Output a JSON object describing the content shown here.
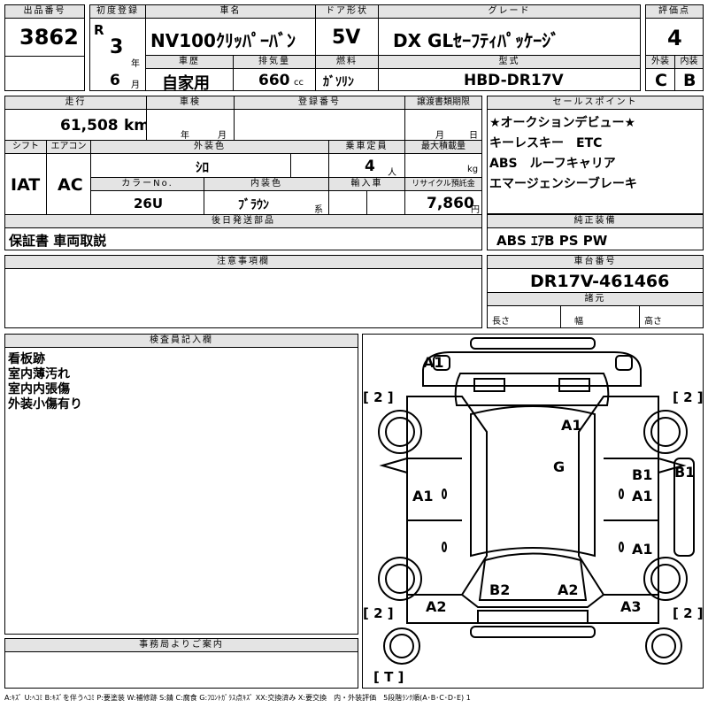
{
  "header": {
    "lot_no_label": "出品番号",
    "lot_no": "3862",
    "first_reg_label": "初度登録",
    "era": "R",
    "reg_year": "3",
    "year_unit": "年",
    "reg_month": "6",
    "month_unit": "月",
    "car_name_label": "車名",
    "car_name": "NV100ｸﾘｯﾊﾟｰﾊﾞﾝ",
    "door_label": "ドア形状",
    "door": "5V",
    "grade_label": "グレード",
    "grade": "DX GLｾｰﾌﾃｨﾊﾟｯｹｰｼﾞ",
    "score_label": "評価点",
    "score": "4",
    "history_label": "車歴",
    "history": "自家用",
    "displacement_label": "排気量",
    "displacement": "660",
    "displacement_unit": "cc",
    "fuel_label": "燃料",
    "fuel": "ｶﾞｿﾘﾝ",
    "model_label": "型式",
    "model": "HBD-DR17V",
    "exterior_label": "外装",
    "exterior": "C",
    "interior_label": "内装",
    "interior": "B"
  },
  "details": {
    "mileage_label": "走行",
    "mileage": "61,508",
    "mileage_unit": "km",
    "inspection_label": "車検",
    "insp_year_unit": "年",
    "insp_month_unit": "月",
    "plate_label": "登録番号",
    "transfer_label": "譲渡書類期限",
    "transfer_month_unit": "月",
    "transfer_day_unit": "日",
    "shift_label": "シフト",
    "shift": "IAT",
    "ac_label": "エアコン",
    "ac": "AC",
    "ext_color_label": "外装色",
    "ext_color": "ｼﾛ",
    "seats_label": "乗車定員",
    "seats": "4",
    "seats_unit": "人",
    "max_load_label": "最大積載量",
    "max_load_unit": "kg",
    "color_no_label": "カラーNo.",
    "color_no": "26U",
    "int_color_label": "内装色",
    "int_color": "ﾌﾞﾗｳﾝ",
    "int_color_unit": "系",
    "import_label": "輸入車",
    "recycle_label": "リサイクル預託金",
    "recycle": "7,860",
    "recycle_unit": "円",
    "later_items_label": "後日発送部品",
    "later_items": "保証書 車両取説",
    "notes_label": "注意事項欄"
  },
  "selling_points": {
    "label": "セールスポイント",
    "lines": [
      "★オークションデビュー★",
      "キーレスキー　ETC",
      "ABS　ルーフキャリア",
      "エマージェンシーブレーキ"
    ]
  },
  "equipment": {
    "label": "純正装備",
    "value": "ABS ｴｱB PS PW"
  },
  "chassis": {
    "label": "車台番号",
    "value": "DR17V-461466",
    "spec_label": "諸元",
    "length_label": "長さ",
    "width_label": "幅",
    "height_label": "高さ"
  },
  "inspector": {
    "label": "検査員記入欄",
    "lines": [
      "看板跡",
      "室内薄汚れ",
      "室内内張傷",
      "外装小傷有り"
    ]
  },
  "diagram": {
    "marks": {
      "m_a1_top": "A1",
      "m_2_tl": "[ 2 ]",
      "m_2_tr": "[ 2 ]",
      "m_a1_roof": "A1",
      "m_g": "G",
      "m_b1_r": "B1",
      "m_b1_side": "B1",
      "m_a1_l": "A1",
      "m_a1_r1": "A1",
      "m_a1_r2": "A1",
      "m_b2": "B2",
      "m_a2_c": "A2",
      "m_a2_l": "A2",
      "m_a3": "A3",
      "m_2_bl": "[ 2 ]",
      "m_2_br": "[ 2 ]",
      "m_t": "[ T ]"
    }
  },
  "office": {
    "label": "事務局よりご案内"
  },
  "legend": "A:ｷｽﾞ U:ﾍｺﾐ B:ｷｽﾞを伴うﾍｺﾐ P:要塗装 W:補修跡 S:錆 C:腐食 G:ﾌﾛﾝﾄｶﾞﾗｽ点ｷｽﾞ XX:交換済み X:要交換　内・外装評価　5段階ﾗﾝｸ順(A･B･C･D･E) 1"
}
